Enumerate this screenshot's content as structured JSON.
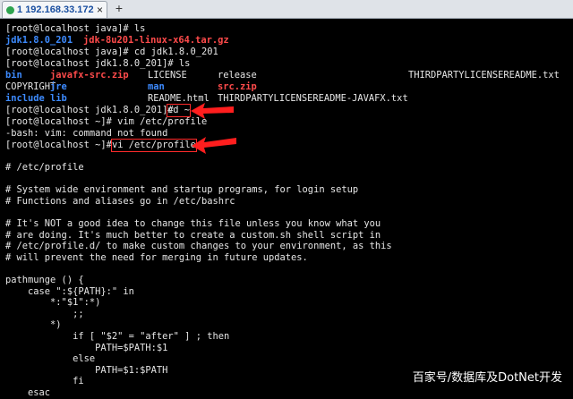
{
  "tab": {
    "index": "1",
    "host": "192.168.33.172",
    "close": "×",
    "add": "+"
  },
  "terminal": {
    "line_ls_cmd": "[root@localhost java]# ls",
    "line_ls_out_a": "jdk1.8.0_201",
    "line_ls_out_b": "jdk-8u201-linux-x64.tar.gz",
    "line_cd_cmd": "[root@localhost java]# cd jdk1.8.0_201",
    "line_ls2_cmd": "[root@localhost jdk1.8.0_201]# ls",
    "ls2_row1": [
      "bin",
      "javafx-src.zip",
      "LICENSE",
      "release",
      "THIRDPARTYLICENSEREADME.txt"
    ],
    "ls2_row2": [
      "COPYRIGHT",
      "jre",
      "man",
      "src.zip"
    ],
    "ls2_row3": [
      "include",
      "lib",
      "README.html",
      "THIRDPARTYLICENSEREADME-JAVAFX.txt"
    ],
    "line_cdhome_prompt": "[root@localhost jdk1.8.0_201]# ",
    "line_cdhome_cmd": "cd ~",
    "line_vim_cmd": "[root@localhost ~]# vim /etc/profile",
    "line_vim_err": "-bash: vim: command not found",
    "line_vi_prompt": "[root@localhost ~]# ",
    "line_vi_cmd": "vi /etc/profile",
    "profile": [
      "# /etc/profile",
      "",
      "# System wide environment and startup programs, for login setup",
      "# Functions and aliases go in /etc/bashrc",
      "",
      "# It's NOT a good idea to change this file unless you know what you",
      "# are doing. It's much better to create a custom.sh shell script in",
      "# /etc/profile.d/ to make custom changes to your environment, as this",
      "# will prevent the need for merging in future updates.",
      "",
      "pathmunge () {",
      "    case \":${PATH}:\" in",
      "        *:\"$1\":*)",
      "            ;;",
      "        *)",
      "            if [ \"$2\" = \"after\" ] ; then",
      "                PATH=$PATH:$1",
      "            else",
      "                PATH=$1:$PATH",
      "            fi",
      "    esac"
    ]
  },
  "watermark": "百家号/数据库及DotNet开发"
}
